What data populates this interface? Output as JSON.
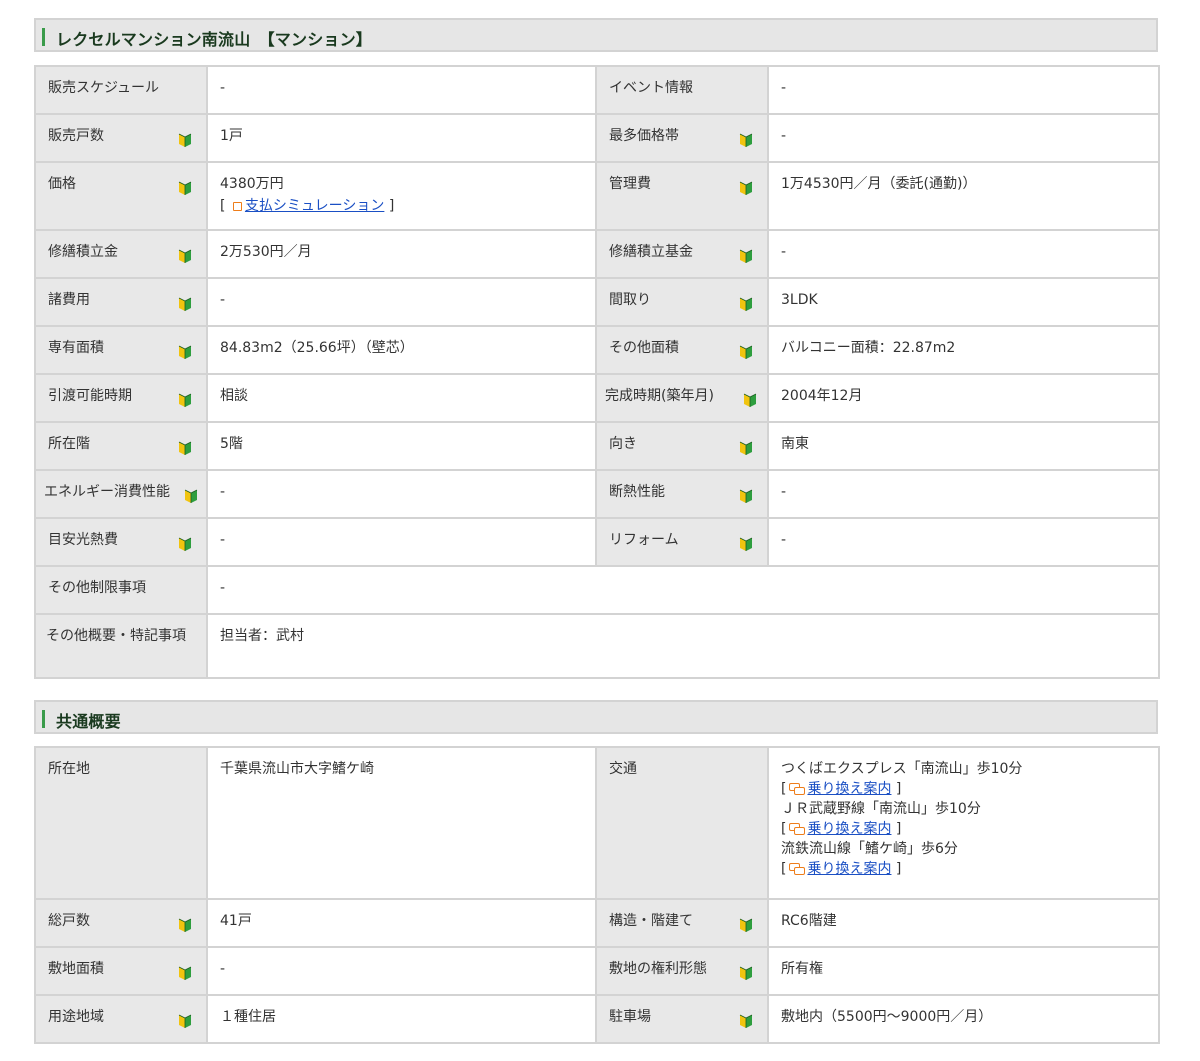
{
  "section1": {
    "title": "レクセルマンション南流山　【マンション】",
    "rows": [
      {
        "l1": "販売スケジュール",
        "v1": "-",
        "l2": "イベント情報",
        "v2": "-"
      },
      {
        "l1": "販売戸数",
        "v1": "1戸",
        "l2": "最多価格帯",
        "v2": "-"
      },
      {
        "l1": "価格",
        "v1": "4380万円",
        "v1_link": "支払シミュレーション",
        "l2": "管理費",
        "v2": "1万4530円／月（委託(通勤)）"
      },
      {
        "l1": "修繕積立金",
        "v1": "2万530円／月",
        "l2": "修繕積立基金",
        "v2": "-"
      },
      {
        "l1": "諸費用",
        "v1": "-",
        "l2": "間取り",
        "v2": "3LDK"
      },
      {
        "l1": "専有面積",
        "v1": "84.83m2（25.66坪）（壁芯）",
        "l2": "その他面積",
        "v2": "バルコニー面積：22.87m2"
      },
      {
        "l1": "引渡可能時期",
        "v1": "相談",
        "l2": "完成時期(築年月)",
        "v2": "2004年12月"
      },
      {
        "l1": "所在階",
        "v1": "5階",
        "l2": "向き",
        "v2": "南東"
      },
      {
        "l1": "エネルギー消費性能",
        "v1": "-",
        "l2": "断熱性能",
        "v2": "-"
      },
      {
        "l1": "目安光熱費",
        "v1": "-",
        "l2": "リフォーム",
        "v2": "-"
      }
    ],
    "wide_rows": [
      {
        "label": "その他制限事項",
        "value": "-"
      },
      {
        "label": "その他概要・特記事項",
        "value": "担当者：武村"
      }
    ]
  },
  "section2": {
    "title": "共通概要",
    "address_label": "所在地",
    "address_value": "千葉県流山市大字鰭ケ崎",
    "transport_label": "交通",
    "transport": [
      {
        "line": "つくばエクスプレス「南流山」歩10分",
        "link": "乗り換え案内"
      },
      {
        "line": "ＪＲ武蔵野線「南流山」歩10分",
        "link": "乗り換え案内"
      },
      {
        "line": "流鉄流山線「鰭ケ崎」歩6分",
        "link": "乗り換え案内"
      }
    ],
    "rows": [
      {
        "l1": "総戸数",
        "v1": "41戸",
        "l2": "構造・階建て",
        "v2": "RC6階建"
      },
      {
        "l1": "敷地面積",
        "v1": "-",
        "l2": "敷地の権利形態",
        "v2": "所有権"
      },
      {
        "l1": "用途地域",
        "v1": "１種住居",
        "l2": "駐車場",
        "v2": "敷地内（5500円〜9000円／月）"
      }
    ]
  },
  "colors": {
    "accent_green": "#3a9b4a",
    "header_bg": "#e6e6e6",
    "label_bg": "#e8e8e8",
    "link": "#1a4fc4",
    "icon_orange": "#ee7d1a"
  }
}
